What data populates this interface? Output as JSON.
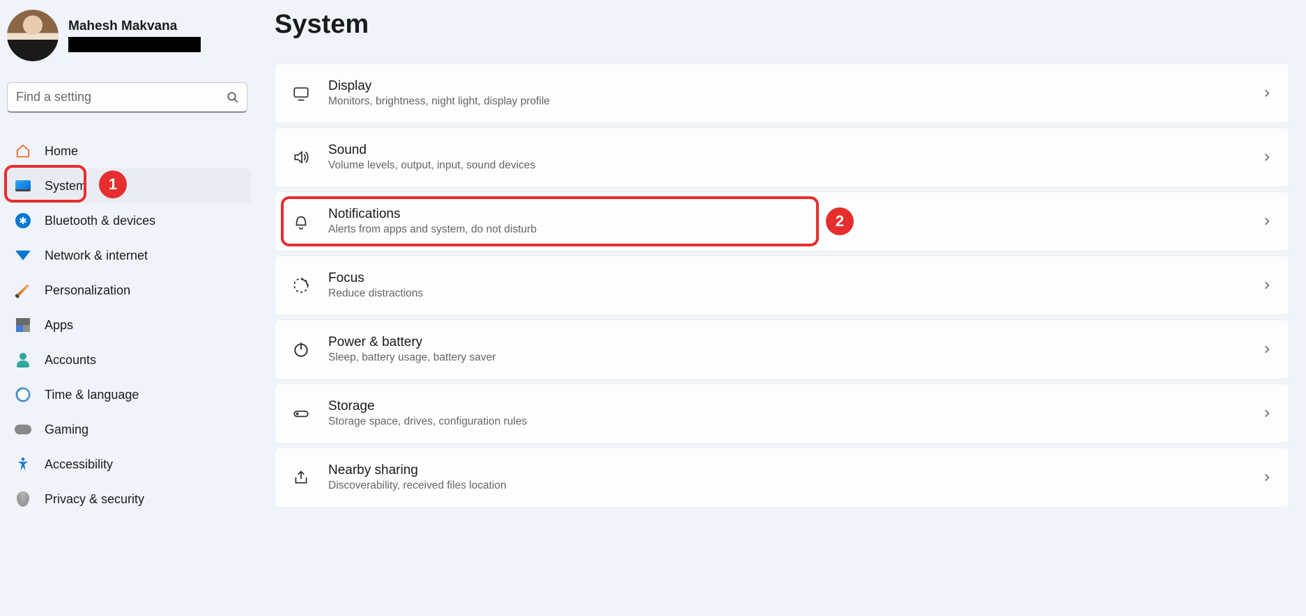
{
  "profile": {
    "name": "Mahesh Makvana"
  },
  "search": {
    "placeholder": "Find a setting"
  },
  "sidebar": {
    "items": [
      {
        "label": "Home",
        "icon": "home"
      },
      {
        "label": "System",
        "icon": "system"
      },
      {
        "label": "Bluetooth & devices",
        "icon": "bluetooth"
      },
      {
        "label": "Network & internet",
        "icon": "network"
      },
      {
        "label": "Personalization",
        "icon": "personalization"
      },
      {
        "label": "Apps",
        "icon": "apps"
      },
      {
        "label": "Accounts",
        "icon": "accounts"
      },
      {
        "label": "Time & language",
        "icon": "time"
      },
      {
        "label": "Gaming",
        "icon": "gaming"
      },
      {
        "label": "Accessibility",
        "icon": "accessibility"
      },
      {
        "label": "Privacy & security",
        "icon": "privacy"
      }
    ]
  },
  "page": {
    "title": "System"
  },
  "settings": [
    {
      "title": "Display",
      "desc": "Monitors, brightness, night light, display profile",
      "icon": "display"
    },
    {
      "title": "Sound",
      "desc": "Volume levels, output, input, sound devices",
      "icon": "sound"
    },
    {
      "title": "Notifications",
      "desc": "Alerts from apps and system, do not disturb",
      "icon": "bell"
    },
    {
      "title": "Focus",
      "desc": "Reduce distractions",
      "icon": "focus"
    },
    {
      "title": "Power & battery",
      "desc": "Sleep, battery usage, battery saver",
      "icon": "power"
    },
    {
      "title": "Storage",
      "desc": "Storage space, drives, configuration rules",
      "icon": "storage"
    },
    {
      "title": "Nearby sharing",
      "desc": "Discoverability, received files location",
      "icon": "share"
    }
  ],
  "annotations": {
    "badge1": "1",
    "badge2": "2"
  }
}
